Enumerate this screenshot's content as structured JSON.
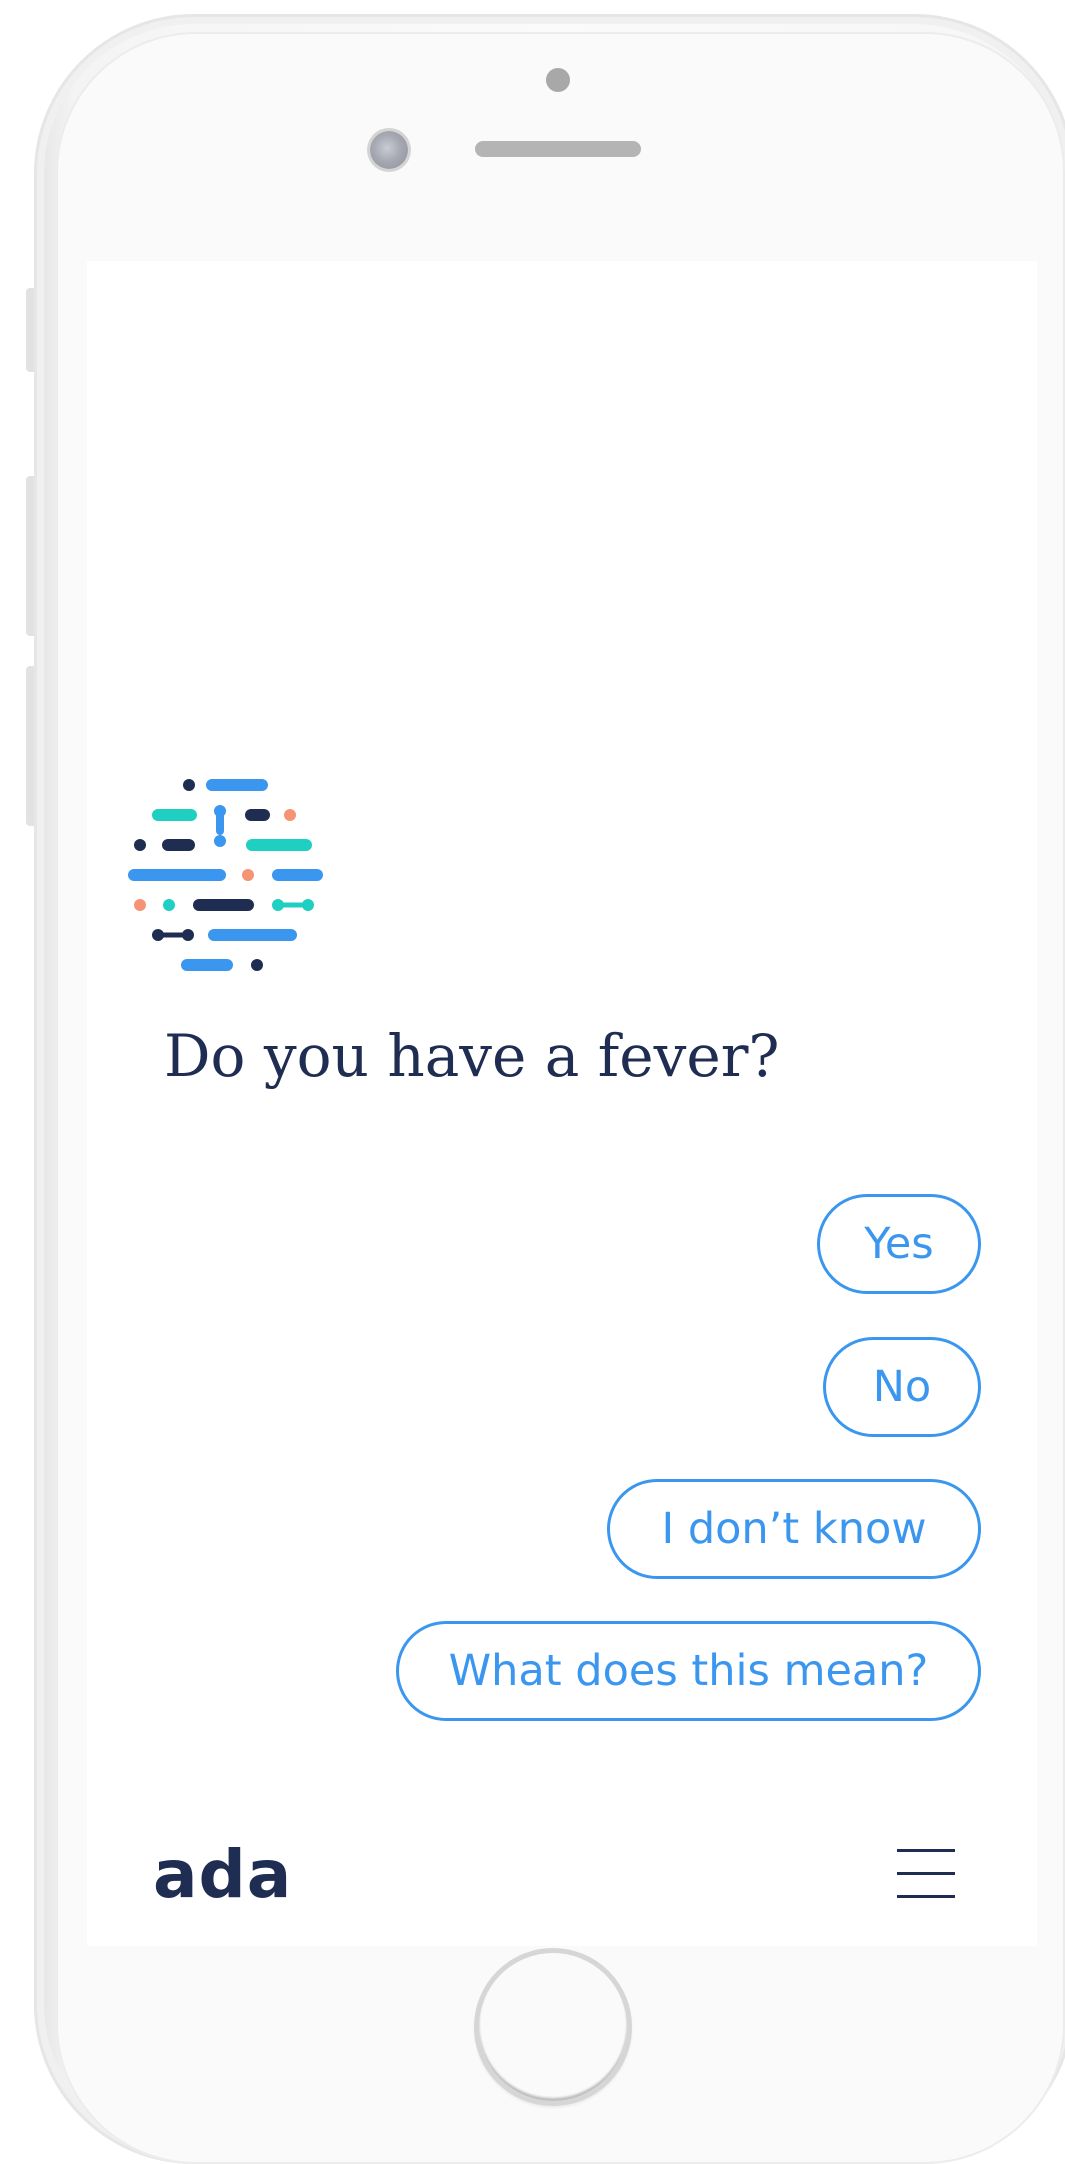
{
  "chat": {
    "question": "Do you have a fever?",
    "answers": [
      "Yes",
      "No",
      "I don’t know",
      "What does this mean?"
    ]
  },
  "footer": {
    "brand": "ada",
    "menu_icon": "hamburger-menu-icon"
  },
  "colors": {
    "question_text": "#1f2d52",
    "answer_accent": "#3a96ef",
    "logo_navy": "#1f2d52",
    "logo_blue": "#3a96ef",
    "logo_teal": "#1fcfc1",
    "logo_orange": "#f59475",
    "screen_background": "#ffffff",
    "phone_frame": "#f4f4f4"
  },
  "icons": {
    "logo": "ada-dot-logo-icon",
    "camera": "front-camera-icon",
    "speaker": "speaker-icon",
    "home": "home-button-icon"
  }
}
